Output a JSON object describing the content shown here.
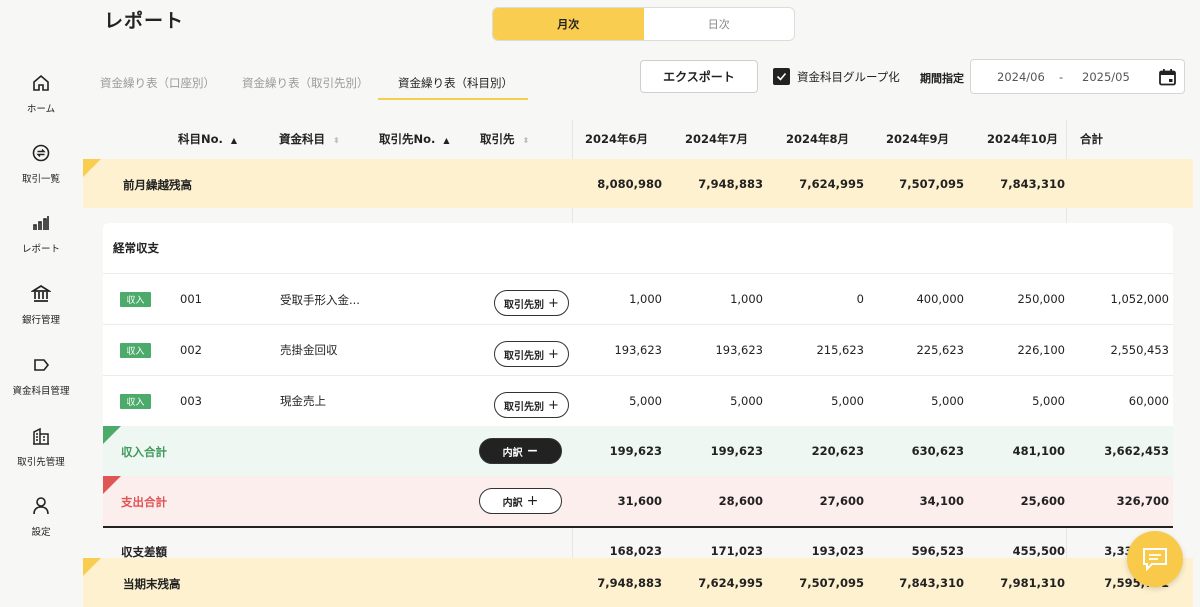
{
  "page": {
    "title": "レポート"
  },
  "view_toggle": {
    "monthly": "月次",
    "daily": "日次"
  },
  "tabs": [
    "資金繰り表（口座別）",
    "資金繰り表（取引先別）",
    "資金繰り表（科目別）"
  ],
  "toolbar": {
    "export_label": "エクスポート",
    "group_label": "資金科目グループ化",
    "period_label": "期間指定",
    "date_from": "2024/06",
    "date_sep": "-",
    "date_to": "2025/05"
  },
  "sidebar": [
    {
      "label": "ホーム",
      "icon": "home-icon"
    },
    {
      "label": "取引一覧",
      "icon": "exchange-icon"
    },
    {
      "label": "レポート",
      "icon": "bar-chart-icon"
    },
    {
      "label": "銀行管理",
      "icon": "bank-icon"
    },
    {
      "label": "資金科目管理",
      "icon": "tag-icon"
    },
    {
      "label": "取引先管理",
      "icon": "building-icon"
    },
    {
      "label": "設定",
      "icon": "user-icon"
    }
  ],
  "columns": {
    "account_no": "科目No.",
    "account": "資金科目",
    "partner_no": "取引先No.",
    "partner": "取引先",
    "months": [
      "2024年6月",
      "2024年7月",
      "2024年8月",
      "2024年9月",
      "2024年10月"
    ],
    "total": "合計"
  },
  "opening": {
    "label": "前月繰越残高",
    "values": [
      "8,080,980",
      "7,948,883",
      "7,624,995",
      "7,507,095",
      "7,843,310"
    ],
    "total": ""
  },
  "section": {
    "label": "経常収支"
  },
  "items": [
    {
      "badge": "収入",
      "no": "001",
      "name": "受取手形入金...",
      "button": "取引先別",
      "values": [
        "1,000",
        "1,000",
        "0",
        "400,000",
        "250,000"
      ],
      "total": "1,052,000"
    },
    {
      "badge": "収入",
      "no": "002",
      "name": "売掛金回収",
      "button": "取引先別",
      "values": [
        "193,623",
        "193,623",
        "215,623",
        "225,623",
        "226,100"
      ],
      "total": "2,550,453"
    },
    {
      "badge": "収入",
      "no": "003",
      "name": "現金売上",
      "button": "取引先別",
      "values": [
        "5,000",
        "5,000",
        "5,000",
        "5,000",
        "5,000"
      ],
      "total": "60,000"
    }
  ],
  "income_total": {
    "label": "収入合計",
    "button": "内訳",
    "values": [
      "199,623",
      "199,623",
      "220,623",
      "630,623",
      "481,100"
    ],
    "total": "3,662,453"
  },
  "expense_total": {
    "label": "支出合計",
    "button": "内訳",
    "values": [
      "31,600",
      "28,600",
      "27,600",
      "34,100",
      "25,600"
    ],
    "total": "326,700"
  },
  "balance": {
    "label": "収支差額",
    "values": [
      "168,023",
      "171,023",
      "193,023",
      "596,523",
      "455,500"
    ],
    "total": "3,335,753"
  },
  "closing": {
    "label": "当期末残高",
    "values": [
      "7,948,883",
      "7,624,995",
      "7,507,095",
      "7,843,310",
      "7,981,310"
    ],
    "total": "7,595,771"
  },
  "colors": {
    "accent": "#f9cd50",
    "income": "#4cab6a",
    "expense": "#e05555"
  }
}
